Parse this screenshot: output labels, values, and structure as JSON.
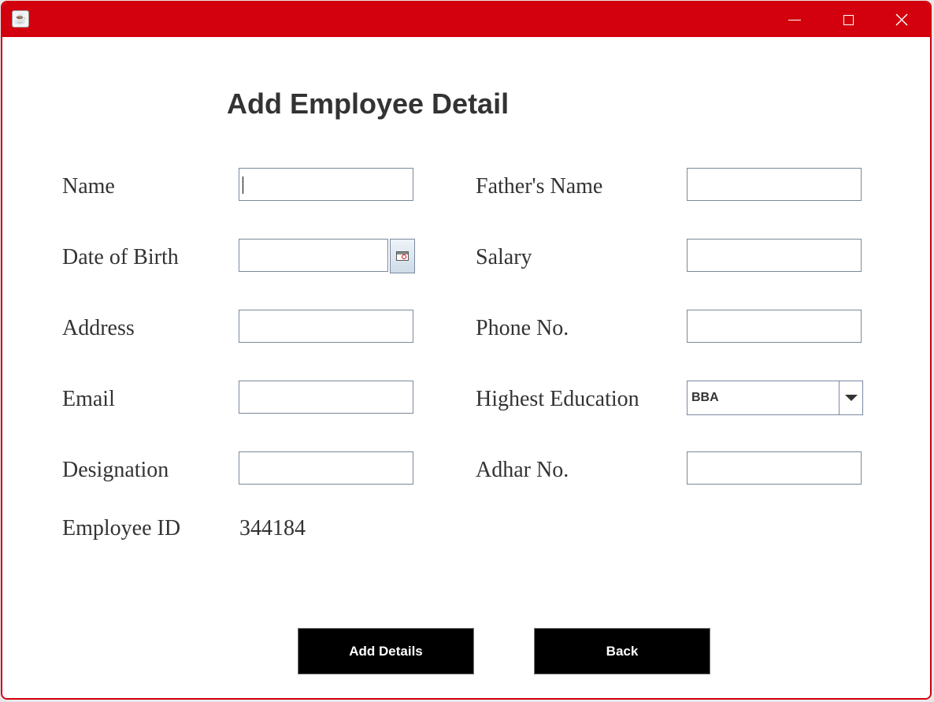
{
  "window": {
    "app_icon": "java-coffee-icon",
    "controls": [
      "minimize-icon",
      "maximize-icon",
      "close-icon"
    ]
  },
  "form": {
    "title": "Add Employee Detail",
    "left_labels": {
      "name": "Name",
      "dob": "Date of Birth",
      "address": "Address",
      "email": "Email",
      "designation": "Designation",
      "employee_id": "Employee ID"
    },
    "right_labels": {
      "father_name": "Father's Name",
      "salary": "Salary",
      "phone": "Phone No.",
      "education": "Highest Education",
      "adhar": "Adhar No."
    },
    "values": {
      "name": "",
      "father_name": "",
      "dob": "",
      "salary": "",
      "address": "",
      "phone": "",
      "email": "",
      "designation": "",
      "adhar": "",
      "education_selected": "BBA",
      "employee_id": "344184"
    },
    "buttons": {
      "add": "Add Details",
      "back": "Back"
    }
  },
  "colors": {
    "titlebar": "#d3000d",
    "button_bg": "#000000",
    "button_text": "#ffffff",
    "text": "#333333"
  }
}
